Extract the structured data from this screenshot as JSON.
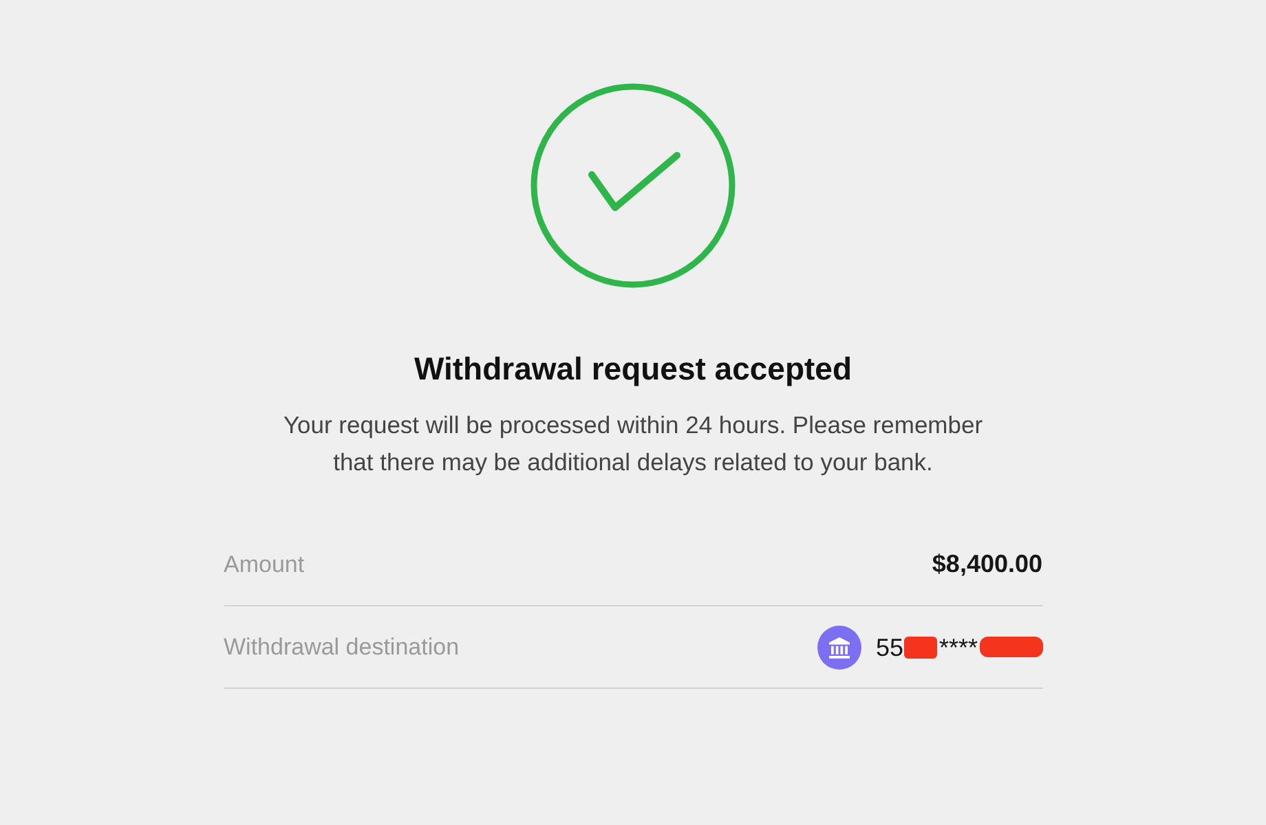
{
  "status": {
    "kind": "success"
  },
  "title": "Withdrawal request accepted",
  "message": "Your request will be processed within 24 hours. Please remember that there may be additional delays related to your bank.",
  "details": [
    {
      "kind": "amount",
      "label": "Amount",
      "value": "$8,400.00"
    },
    {
      "kind": "account",
      "label": "Withdrawal destination",
      "account_parts": [
        {
          "kind": "text",
          "text": "55"
        },
        {
          "kind": "redacted"
        },
        {
          "kind": "text",
          "text": "****"
        },
        {
          "kind": "redacted"
        }
      ]
    }
  ]
}
